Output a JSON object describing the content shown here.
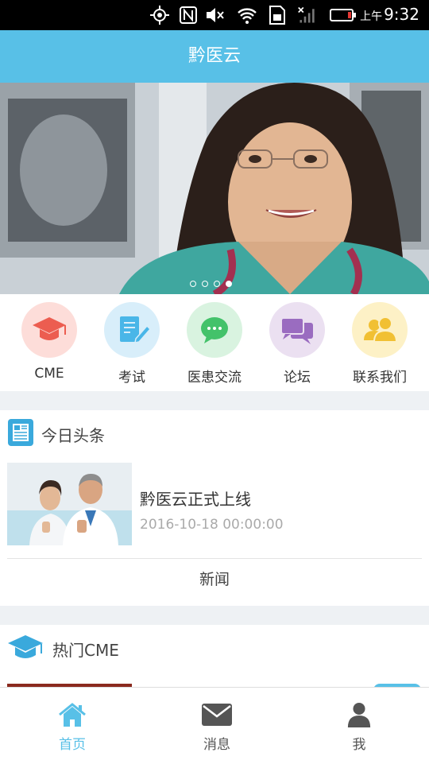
{
  "status_bar": {
    "ampm": "上午",
    "time": "9:32"
  },
  "app_bar": {
    "title": "黔医云"
  },
  "banner": {
    "dots_total": 4,
    "active_index": 3
  },
  "quick_menu": [
    {
      "label": "CME",
      "icon": "graduation-cap-icon",
      "bg": "#fdddd9",
      "color": "#ec5d50"
    },
    {
      "label": "考试",
      "icon": "exam-edit-icon",
      "bg": "#d8eefa",
      "color": "#49b6e8"
    },
    {
      "label": "医患交流",
      "icon": "chat-bubble-icon",
      "bg": "#d9f3e0",
      "color": "#43c26a"
    },
    {
      "label": "论坛",
      "icon": "forum-icon",
      "bg": "#ebe0f1",
      "color": "#9a6cc0"
    },
    {
      "label": "联系我们",
      "icon": "contacts-icon",
      "bg": "#fdf1c6",
      "color": "#f1c033"
    }
  ],
  "headlines": {
    "title": "今日头条",
    "item": {
      "title": "黔医云正式上线",
      "date": "2016-10-18 00:00:00"
    },
    "more_label": "新闻"
  },
  "hot_cme": {
    "title": "热门CME"
  },
  "tabs": [
    {
      "label": "首页",
      "icon": "home-icon",
      "active": true
    },
    {
      "label": "消息",
      "icon": "mail-icon",
      "active": false
    },
    {
      "label": "我",
      "icon": "user-icon",
      "active": false
    }
  ],
  "colors": {
    "primary": "#58c0e7",
    "tab_inactive": "#555555"
  }
}
